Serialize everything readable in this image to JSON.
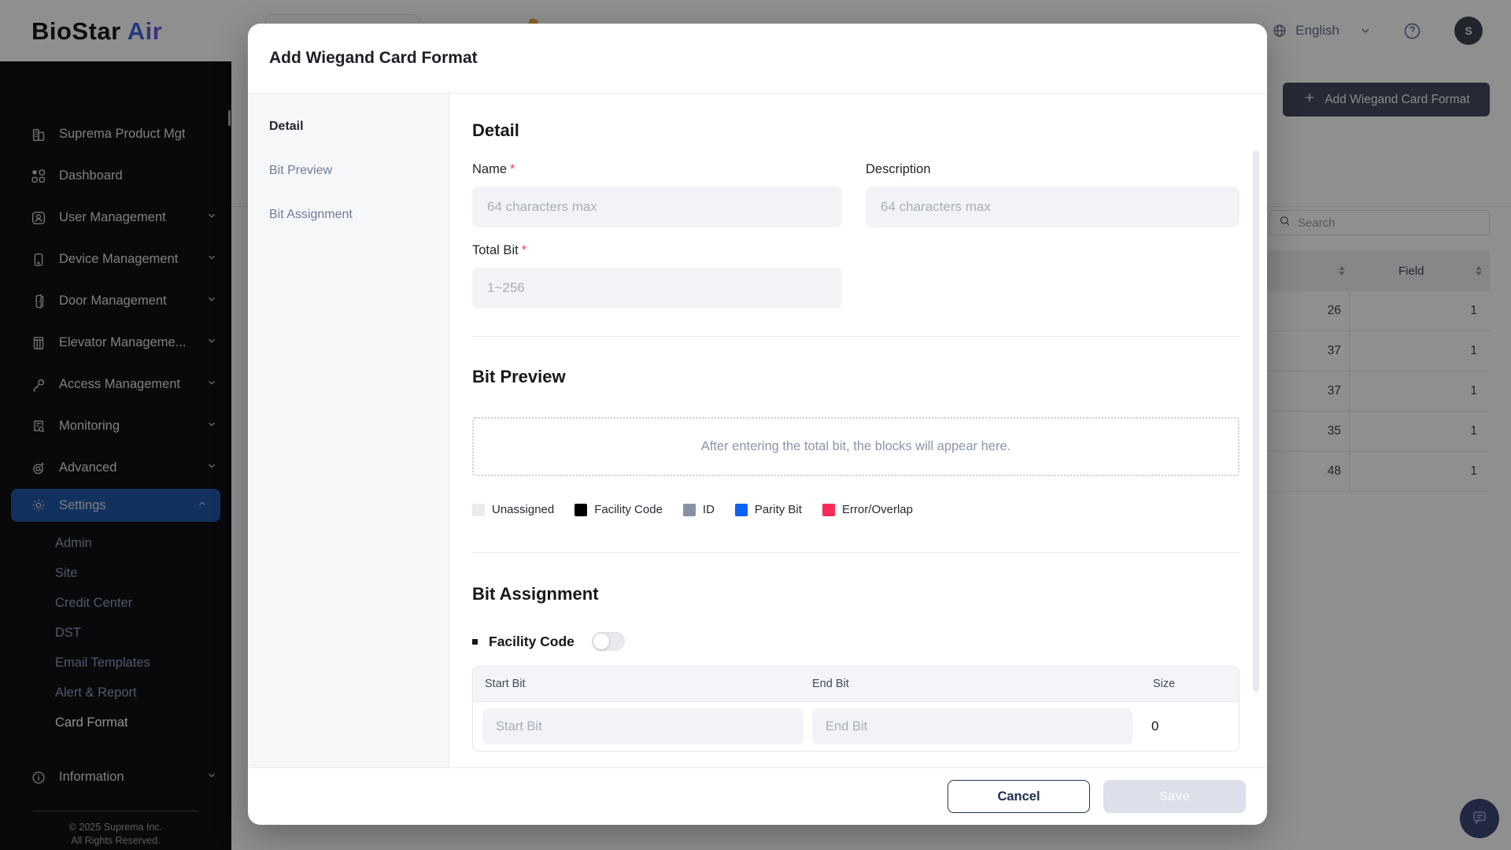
{
  "brand": {
    "name_primary": "BioStar",
    "name_secondary": "Air"
  },
  "header": {
    "language_label": "English",
    "avatar_initial": "S",
    "icons": [
      "globe-icon",
      "chevron-down-icon",
      "help-icon"
    ]
  },
  "sidebar": {
    "items": [
      {
        "label": "Suprema Product Mgt",
        "icon": "building-icon"
      },
      {
        "label": "Dashboard",
        "icon": "dashboard-grid-icon"
      },
      {
        "label": "User Management",
        "icon": "user-icon",
        "chevron": "down"
      },
      {
        "label": "Device Management",
        "icon": "device-icon",
        "chevron": "down"
      },
      {
        "label": "Door Management",
        "icon": "door-icon",
        "chevron": "down"
      },
      {
        "label": "Elevator Manageme...",
        "icon": "elevator-icon",
        "chevron": "down"
      },
      {
        "label": "Access Management",
        "icon": "key-icon",
        "chevron": "down"
      },
      {
        "label": "Monitoring",
        "icon": "monitoring-icon",
        "chevron": "down"
      },
      {
        "label": "Advanced",
        "icon": "advanced-icon",
        "chevron": "down"
      },
      {
        "label": "Settings",
        "icon": "gear-icon",
        "chevron": "up",
        "active": true
      }
    ],
    "settings_submenu": [
      {
        "label": "Admin"
      },
      {
        "label": "Site"
      },
      {
        "label": "Credit Center"
      },
      {
        "label": "DST"
      },
      {
        "label": "Email Templates"
      },
      {
        "label": "Alert & Report"
      },
      {
        "label": "Card Format",
        "active": true
      }
    ],
    "information_label": "Information",
    "copyright_line1": "© 2025 Suprema Inc.",
    "copyright_line2": "All Rights Reserved.",
    "highlight_color": "#2058aa"
  },
  "background_page": {
    "add_button_label": "Add Wiegand Card Format",
    "search_placeholder": "Search",
    "table": {
      "field_header": "Field",
      "rows": [
        {
          "c1": "26",
          "field": "1"
        },
        {
          "c1": "37",
          "field": "1"
        },
        {
          "c1": "37",
          "field": "1"
        },
        {
          "c1": "35",
          "field": "1"
        },
        {
          "c1": "48",
          "field": "1"
        }
      ]
    }
  },
  "modal": {
    "title": "Add Wiegand Card Format",
    "nav": [
      {
        "label": "Detail",
        "active": true
      },
      {
        "label": "Bit Preview"
      },
      {
        "label": "Bit Assignment"
      }
    ],
    "detail": {
      "heading": "Detail",
      "name_label": "Name",
      "required_marker": "*",
      "name_placeholder": "64 characters max",
      "description_label": "Description",
      "description_placeholder": "64 characters max",
      "total_bit_label": "Total Bit",
      "total_bit_placeholder": "1~256"
    },
    "bit_preview": {
      "heading": "Bit Preview",
      "empty_message": "After entering the total bit, the blocks will appear here.",
      "legend": [
        {
          "label": "Unassigned",
          "color": "#e9ebef",
          "style": "background:#e9ebef"
        },
        {
          "label": "Facility Code",
          "color": "#000000",
          "style": "background:#000000"
        },
        {
          "label": "ID",
          "color": "#8792a6",
          "style": "background:#8792a6"
        },
        {
          "label": "Parity Bit",
          "color": "#0b63f6",
          "style": "background:#0b63f6"
        },
        {
          "label": "Error/Overlap",
          "color": "#fb2b55",
          "style": "background:#fb2b55"
        }
      ]
    },
    "bit_assignment": {
      "heading": "Bit Assignment",
      "facility_code_label": "Facility Code",
      "toggle_state": "off",
      "col_start": "Start Bit",
      "col_end": "End Bit",
      "col_size": "Size",
      "start_bit_placeholder": "Start Bit",
      "end_bit_placeholder": "End Bit",
      "size_value": "0"
    },
    "footer": {
      "cancel_label": "Cancel",
      "save_label": "Save"
    }
  }
}
